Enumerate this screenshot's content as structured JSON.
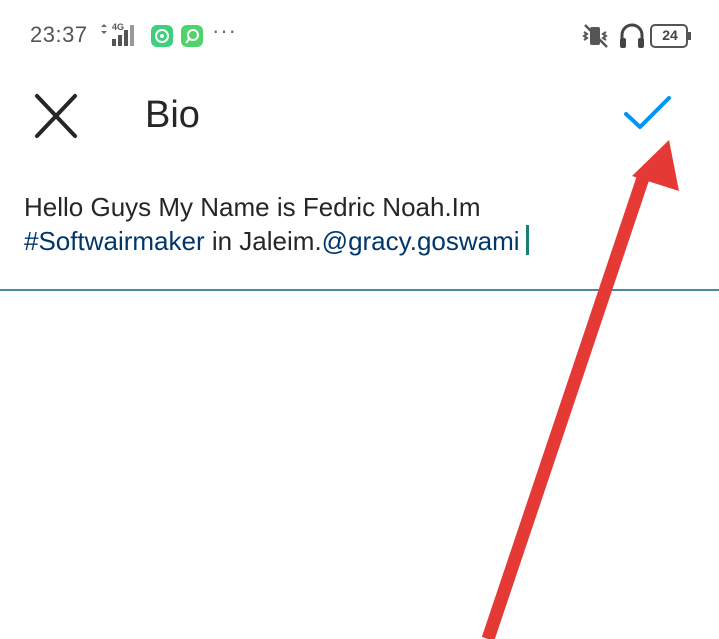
{
  "status_bar": {
    "time": "23:37",
    "network": "4G",
    "more": "···",
    "battery": "24",
    "icons": [
      "signal-icon",
      "app-sync-icon",
      "app-chat-icon",
      "vibrate-off-icon",
      "headset-icon",
      "battery-icon"
    ]
  },
  "toolbar": {
    "close_icon": "close-icon",
    "title": "Bio",
    "done_icon": "checkmark-icon"
  },
  "bio": {
    "line1": "Hello Guys My Name is Fedric Noah.Im",
    "hashtag": "#Softwairmaker",
    "middle": " in Jaleim.",
    "mention": "@gracy.goswami"
  },
  "colors": {
    "accent": "#0095f6",
    "link": "#00376b",
    "cursor": "#1a7f6e",
    "annotation_arrow": "#e53935"
  }
}
